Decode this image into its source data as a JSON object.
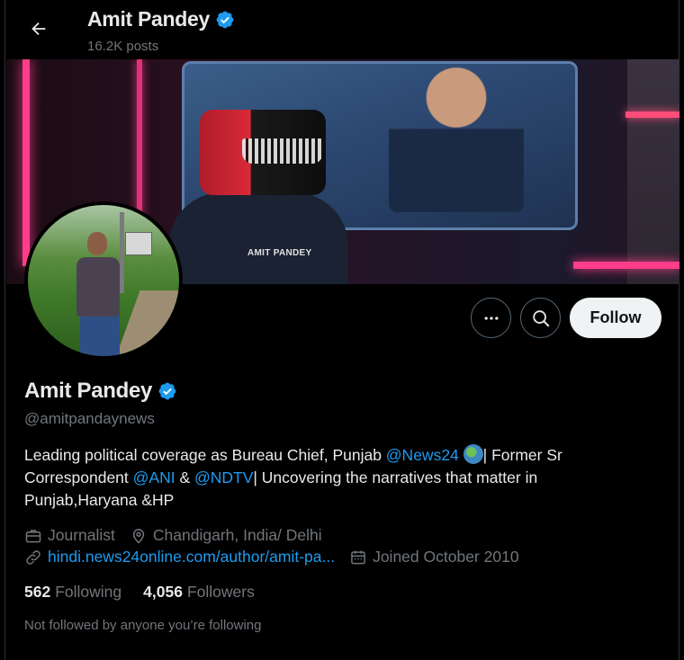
{
  "header": {
    "name": "Amit Pandey",
    "posts": "16.2K posts"
  },
  "banner": {
    "robot_label": "AMIT PANDEY"
  },
  "actions": {
    "follow_label": "Follow"
  },
  "profile": {
    "name": "Amit Pandey",
    "handle": "@amitpandaynews",
    "bio": {
      "part1": "Leading political coverage as Bureau Chief, Punjab ",
      "mention1": "@News24",
      "part2": "| Former Sr Correspondent ",
      "mention2": "@ANI",
      "part3": " & ",
      "mention3": "@NDTV",
      "part4": "| Uncovering the narratives that matter in Punjab,Haryana &HP"
    },
    "profession": "Journalist",
    "location": "Chandigarh, India/ Delhi",
    "website": "hindi.news24online.com/author/amit-pa...",
    "joined": "Joined October 2010"
  },
  "stats": {
    "following_count": "562",
    "following_label": "Following",
    "followers_count": "4,056",
    "followers_label": "Followers"
  },
  "footer": {
    "not_followed": "Not followed by anyone you’re following"
  },
  "icons": {
    "back": "arrow-left-icon",
    "verified": "verified-badge-icon",
    "more": "more-icon",
    "search": "search-icon",
    "briefcase": "briefcase-icon",
    "location": "location-icon",
    "link": "link-icon",
    "calendar": "calendar-icon",
    "globe": "globe-emoji-icon"
  },
  "colors": {
    "accent": "#1d9bf0",
    "muted": "#71767b",
    "text": "#e7e9ea",
    "background": "#000000"
  }
}
